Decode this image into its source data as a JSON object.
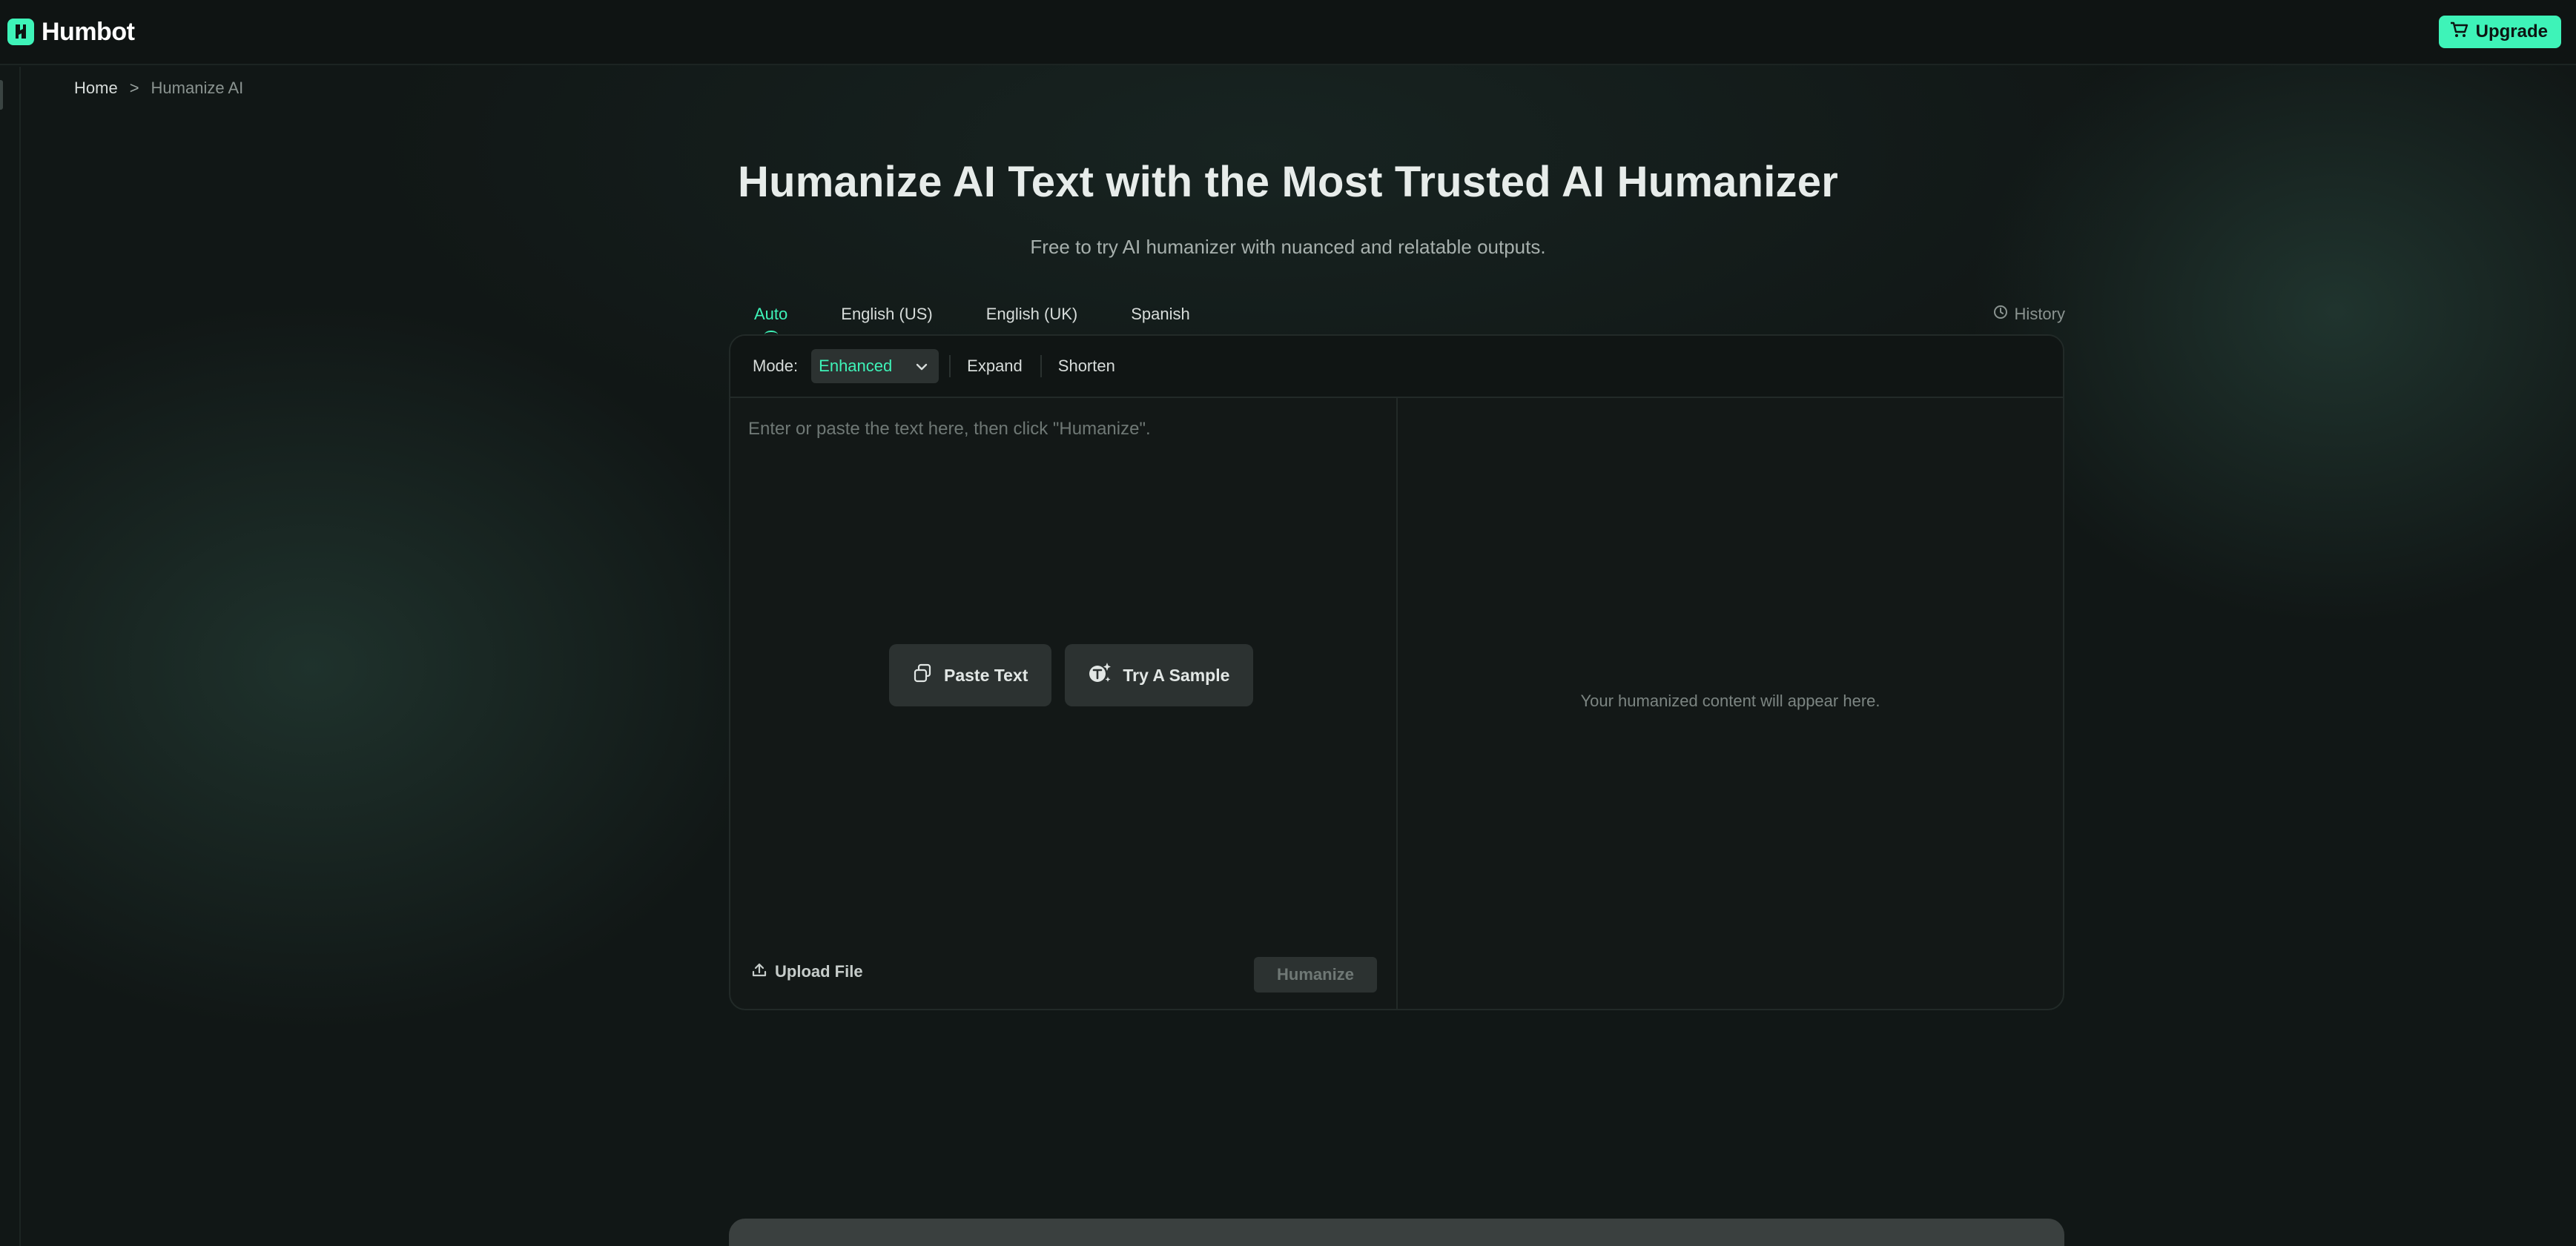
{
  "header": {
    "brand_name": "Humbot",
    "upgrade_label": "Upgrade"
  },
  "breadcrumb": {
    "home": "Home",
    "separator": ">",
    "current": "Humanize AI"
  },
  "hero": {
    "title": "Humanize AI Text with the Most Trusted AI Humanizer",
    "subtitle": "Free to try AI humanizer with nuanced and relatable outputs."
  },
  "language_tabs": [
    {
      "label": "Auto",
      "active": true
    },
    {
      "label": "English (US)",
      "active": false
    },
    {
      "label": "English (UK)",
      "active": false
    },
    {
      "label": "Spanish",
      "active": false
    }
  ],
  "history_label": "History",
  "mode_bar": {
    "label": "Mode:",
    "selected": "Enhanced",
    "options": [
      "Expand",
      "Shorten"
    ]
  },
  "input": {
    "placeholder": "Enter or paste the text here, then click \"Humanize\".",
    "paste_label": "Paste Text",
    "sample_label": "Try A Sample",
    "upload_label": "Upload File",
    "humanize_label": "Humanize"
  },
  "output": {
    "placeholder": "Your humanized content will appear here."
  },
  "colors": {
    "accent": "#3ef3b8",
    "background": "#111716",
    "card": "#131817"
  }
}
